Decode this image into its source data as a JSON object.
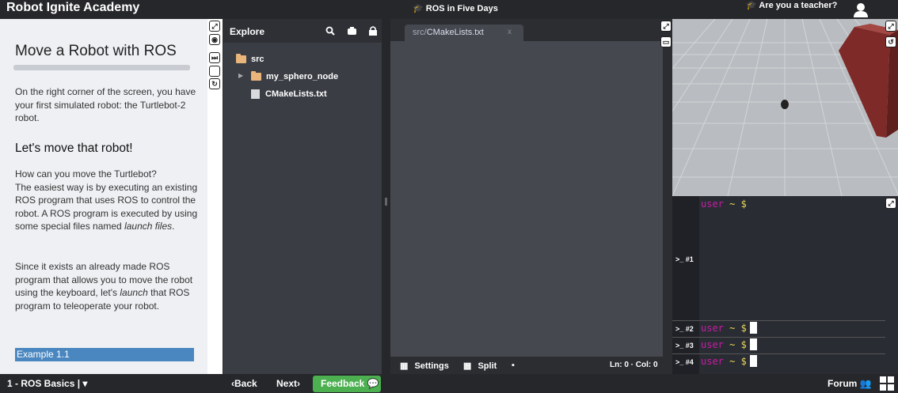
{
  "topbar": {
    "brand": "Robot Ignite Academy",
    "course_title": "ROS in Five Days",
    "teacher_link": "Are you a teacher?"
  },
  "notebook": {
    "title": "Move a Robot with ROS",
    "progress": 1.0,
    "intro": "On the right corner of the screen, you have your first simulated robot: the Turtlebot-2 robot.",
    "heading": "Let's move that robot!",
    "para1_a": "How can you move the Turtlebot?",
    "para1_b": "The easiest way is by executing an existing ROS program that uses ROS to control the robot. A ROS program is executed by using some special files named ",
    "para1_em": "launch files",
    "para1_end": ".",
    "para2_a": "Since it exists an already made ROS program that allows you to move the robot using the keyboard, let's ",
    "para2_em": "launch",
    "para2_b": " that ROS program to teleoperate your robot.",
    "example": "Example 1.1"
  },
  "explore": {
    "title": "Explore",
    "tree": [
      {
        "label": "src",
        "type": "folder"
      },
      {
        "label": "my_sphero_node",
        "type": "folder"
      },
      {
        "label": "CMakeLists.txt",
        "type": "file"
      }
    ]
  },
  "editor": {
    "tab_prefix": "src/",
    "tab_name": "CMakeLists.txt",
    "tab_close": "x",
    "settings": "Settings",
    "split": "Split",
    "position": "Ln: 0 · Col: 0"
  },
  "terminal": {
    "tabs": [
      ">_ #1",
      ">_ #2",
      ">_ #3",
      ">_ #4"
    ],
    "user": "user",
    "tilde": "~",
    "dollar": "$"
  },
  "bottombar": {
    "unit": "1 - ROS Basics |",
    "back": "Back",
    "next": "Next",
    "feedback": "Feedback",
    "forum": "Forum"
  },
  "colors": {
    "feedback_green": "#4caf50",
    "example_blue": "#4a87c0",
    "prompt_user": "#c71ca7",
    "prompt_symbol": "#e8d95a",
    "folder": "#e9b57a"
  }
}
